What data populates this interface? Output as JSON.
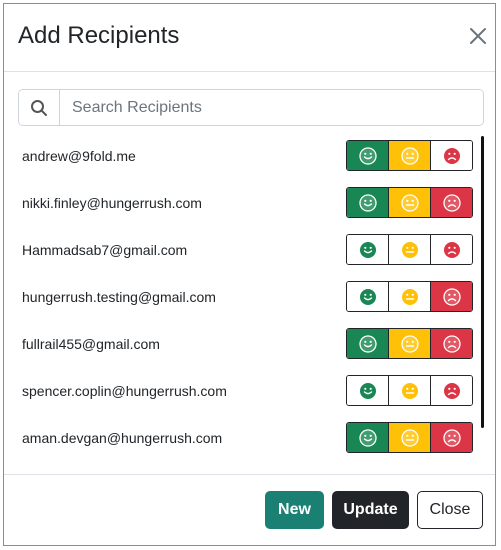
{
  "modal": {
    "title": "Add Recipients",
    "close_icon": "close-icon"
  },
  "search": {
    "icon": "search-icon",
    "placeholder": "Search Recipients",
    "value": ""
  },
  "colors": {
    "happy": "#198754",
    "neutral": "#ffc107",
    "sad": "#dc3545"
  },
  "recipients": [
    {
      "email": "andrew@9fold.me",
      "happy": true,
      "neutral": true,
      "sad": false
    },
    {
      "email": "nikki.finley@hungerrush.com",
      "happy": true,
      "neutral": true,
      "sad": true
    },
    {
      "email": "Hammadsab7@gmail.com",
      "happy": false,
      "neutral": false,
      "sad": false
    },
    {
      "email": "hungerrush.testing@gmail.com",
      "happy": false,
      "neutral": false,
      "sad": true
    },
    {
      "email": "fullrail455@gmail.com",
      "happy": true,
      "neutral": true,
      "sad": true
    },
    {
      "email": "spencer.coplin@hungerrush.com",
      "happy": false,
      "neutral": false,
      "sad": false
    },
    {
      "email": "aman.devgan@hungerrush.com",
      "happy": true,
      "neutral": true,
      "sad": true
    }
  ],
  "footer": {
    "new_label": "New",
    "update_label": "Update",
    "close_label": "Close"
  }
}
